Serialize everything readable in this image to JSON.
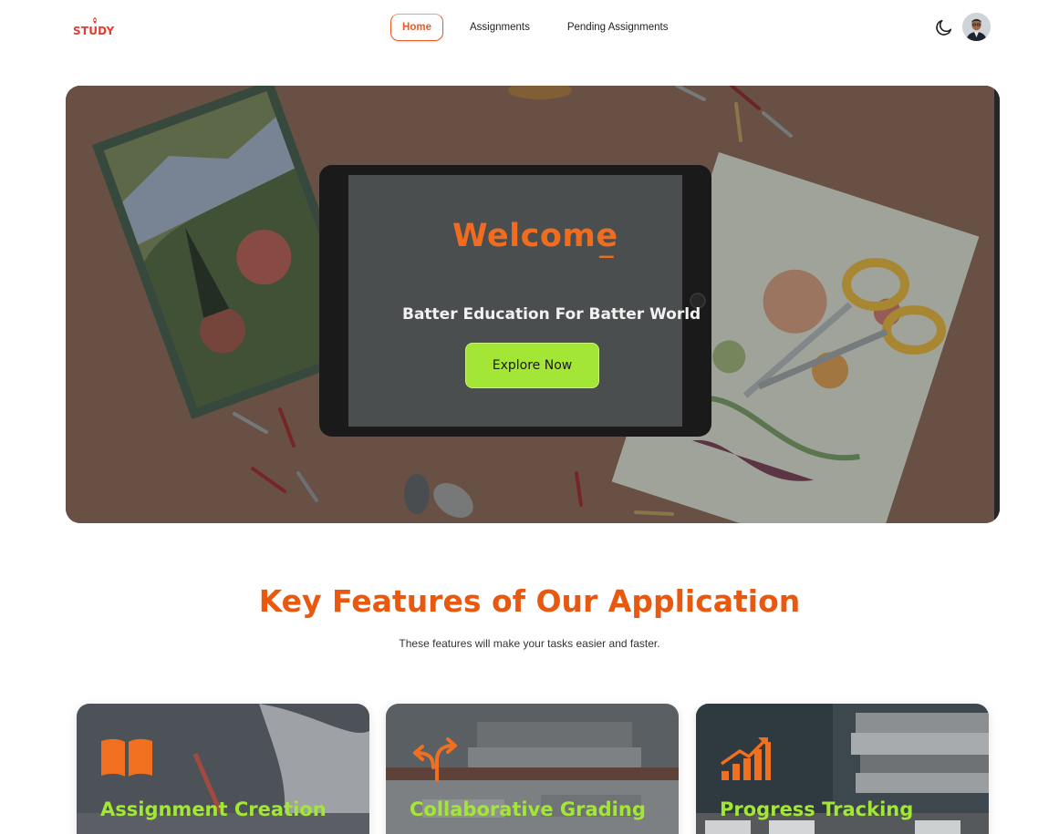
{
  "navbar": {
    "logo_text": "STUDY",
    "links": {
      "home": "Home",
      "assignments": "Assignments",
      "pending": "Pending Assignments"
    },
    "theme_toggle_icon": "moon-icon",
    "avatar_icon": "user-avatar"
  },
  "hero": {
    "welcome": "Welcome",
    "cursor": "_",
    "subtitle": "Batter Education For Batter World",
    "button": "Explore Now"
  },
  "features": {
    "title": "Key Features of Our Application",
    "subtitle": "These features will make your tasks easier and faster.",
    "cards": [
      {
        "title": "Assignment Creation",
        "icon": "book-icon"
      },
      {
        "title": "Collaborative Grading",
        "icon": "split-arrows-icon"
      },
      {
        "title": "Progress Tracking",
        "icon": "growth-chart-icon"
      }
    ]
  },
  "colors": {
    "accent_orange": "#eb5a22",
    "accent_green": "#a3e635",
    "logo_red": "#e63b2e"
  }
}
